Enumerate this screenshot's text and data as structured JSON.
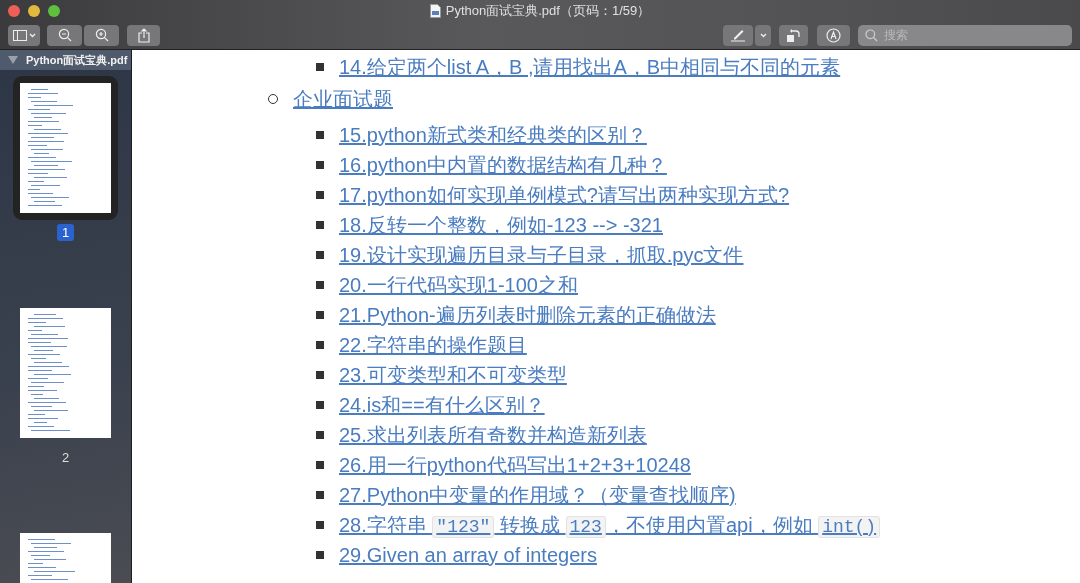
{
  "window": {
    "title": "Python面试宝典.pdf（页码：1/59）"
  },
  "toolbar": {
    "search": {
      "placeholder": "搜索"
    }
  },
  "sidebar": {
    "document": {
      "name": "Python面试宝典.pdf",
      "expanded": true
    },
    "pages": [
      {
        "label": "1",
        "selected": true
      },
      {
        "label": "2",
        "selected": false
      },
      {
        "selected": false
      }
    ]
  },
  "document": {
    "leading_items": [
      {
        "parts": [
          {
            "kind": "text",
            "text": "14.给定两个list A，B ,请用找出A，B中相同与不同的元素"
          }
        ]
      }
    ],
    "sections": [
      {
        "title": "企业面试题",
        "children": [
          {
            "parts": [
              {
                "kind": "text",
                "text": "15.python新式类和经典类的区别？"
              }
            ]
          },
          {
            "parts": [
              {
                "kind": "text",
                "text": "16.python中内置的数据结构有几种？"
              }
            ]
          },
          {
            "parts": [
              {
                "kind": "text",
                "text": "17.python如何实现单例模式?请写出两种实现方式?"
              }
            ]
          },
          {
            "parts": [
              {
                "kind": "text",
                "text": "18.反转一个整数，例如-123 --> -321"
              }
            ]
          },
          {
            "parts": [
              {
                "kind": "text",
                "text": "19.设计实现遍历目录与子目录，抓取.pyc文件"
              }
            ]
          },
          {
            "parts": [
              {
                "kind": "text",
                "text": "20.一行代码实现1-100之和"
              }
            ]
          },
          {
            "parts": [
              {
                "kind": "text",
                "text": "21.Python-遍历列表时删除元素的正确做法"
              }
            ]
          },
          {
            "parts": [
              {
                "kind": "text",
                "text": "22.字符串的操作题目"
              }
            ]
          },
          {
            "parts": [
              {
                "kind": "text",
                "text": "23.可变类型和不可变类型"
              }
            ]
          },
          {
            "parts": [
              {
                "kind": "text",
                "text": "24.is和==有什么区别？"
              }
            ]
          },
          {
            "parts": [
              {
                "kind": "text",
                "text": "25.求出列表所有奇数并构造新列表"
              }
            ]
          },
          {
            "parts": [
              {
                "kind": "text",
                "text": "26.用一行python代码写出1+2+3+10248"
              }
            ]
          },
          {
            "parts": [
              {
                "kind": "text",
                "text": "27.Python中变量的作用域？（变量查找顺序)"
              }
            ]
          },
          {
            "parts": [
              {
                "kind": "text",
                "text": "28.字符串 "
              },
              {
                "kind": "code",
                "text": "\"123\""
              },
              {
                "kind": "text",
                "text": " 转换成 "
              },
              {
                "kind": "code",
                "text": "123"
              },
              {
                "kind": "text",
                "text": "，不使用内置api，例如 "
              },
              {
                "kind": "code",
                "text": "int()"
              }
            ]
          },
          {
            "parts": [
              {
                "kind": "text",
                "text": "29.Given an array of integers"
              }
            ]
          }
        ]
      }
    ]
  }
}
